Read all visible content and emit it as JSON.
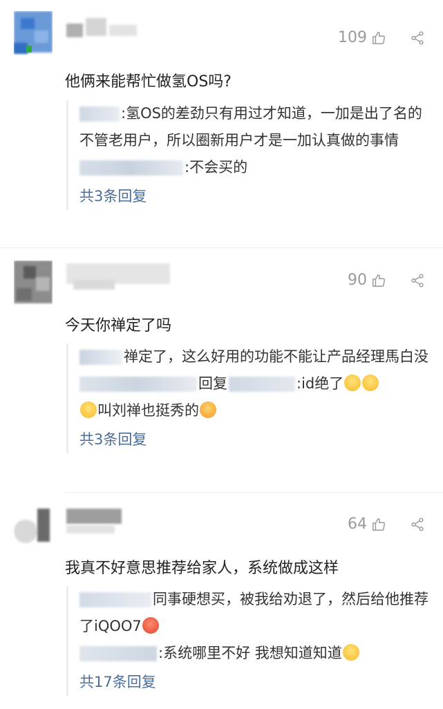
{
  "comments": [
    {
      "likes": "109",
      "text": "他俩来能帮忙做氢OS吗?",
      "replies": [
        {
          "text": ":氢OS的差劲只有用过才知道，一加是出了名的不管老用户，所以圈新用户才是一加认真做的事情"
        },
        {
          "text": ":不会买的"
        }
      ],
      "more": "共3条回复"
    },
    {
      "likes": "90",
      "text": "今天你禅定了吗",
      "replies": [
        {
          "text": "禅定了，这么好用的功能不能让产品经理馬白没"
        },
        {
          "prefix": "回复",
          "text": ":id绝了",
          "tail": "叫刘禅也挺秀的"
        }
      ],
      "more": "共3条回复"
    },
    {
      "likes": "64",
      "text": "我真不好意思推荐给家人，系统做成这样",
      "replies": [
        {
          "text": "同事硬想买，被我给劝退了，然后给他推荐了iQOO7"
        },
        {
          "text": ":系统哪里不好 我想知道知道"
        }
      ],
      "more": "共17条回复"
    }
  ],
  "icons": {
    "like": "thumbs-up-icon",
    "share": "share-icon"
  },
  "colors": {
    "link": "#4a6e9b",
    "muted": "#9a9a9a",
    "avatar1": "#5b8fd6",
    "avatar2": "#8a8a8a",
    "avatar3": "#6f6f6f"
  }
}
